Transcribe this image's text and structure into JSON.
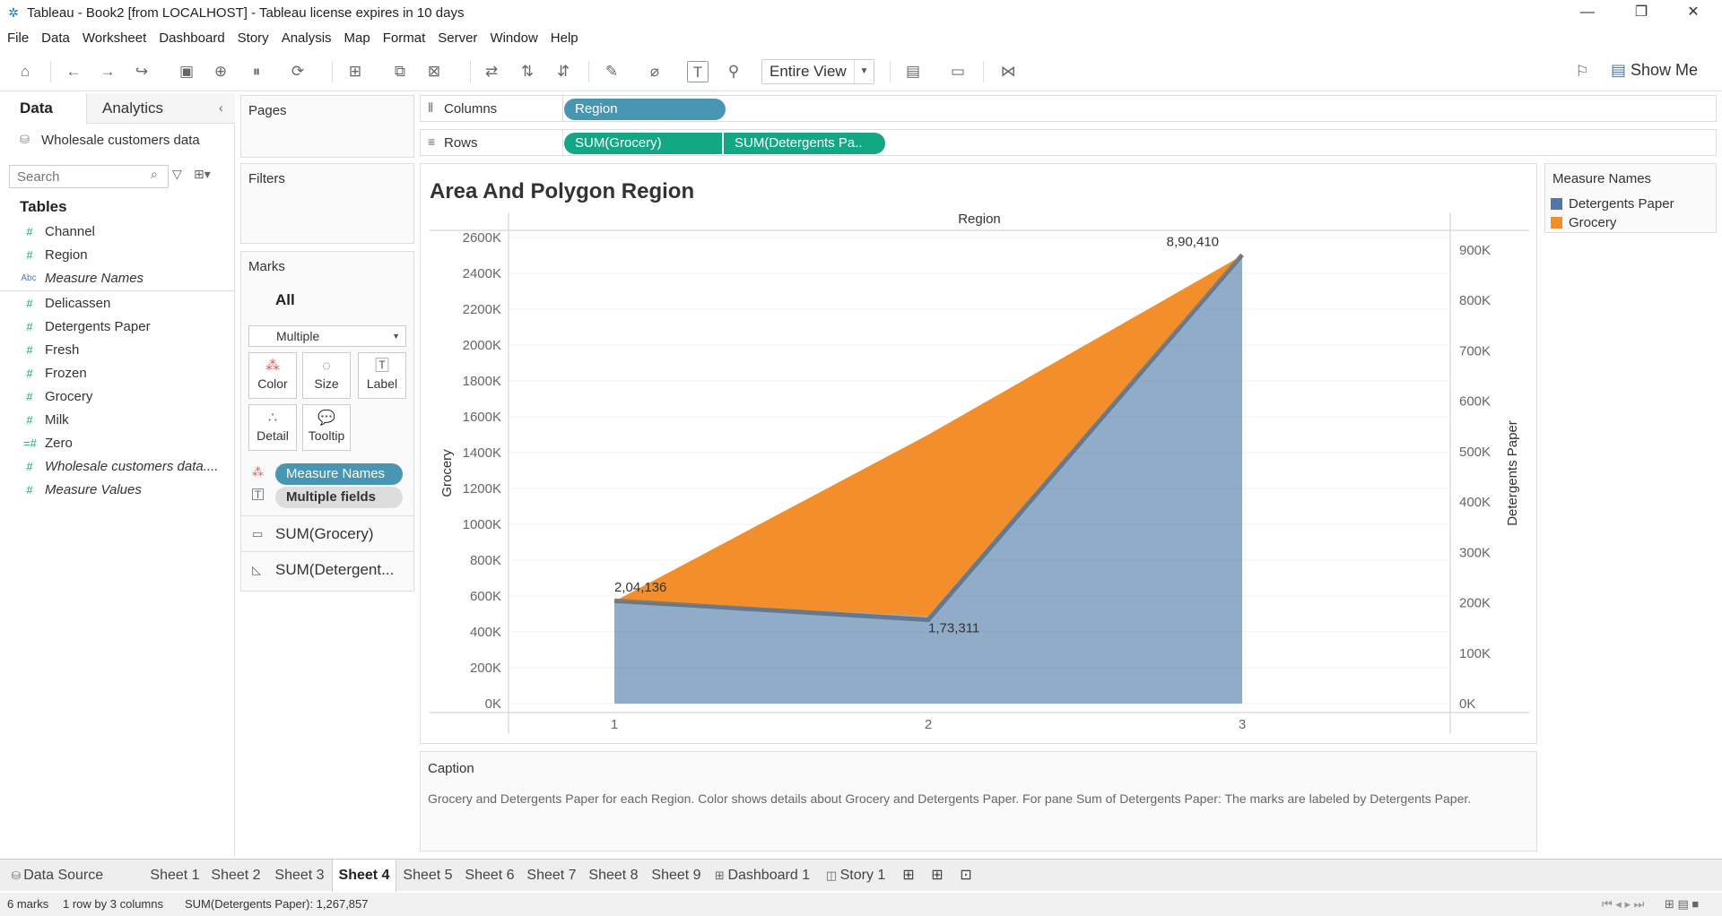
{
  "window": {
    "title": "Tableau - Book2 [from LOCALHOST] - Tableau license expires in 10 days",
    "controls": [
      "minimize",
      "restore",
      "close"
    ]
  },
  "menu": [
    "File",
    "Data",
    "Worksheet",
    "Dashboard",
    "Story",
    "Analysis",
    "Map",
    "Format",
    "Server",
    "Window",
    "Help"
  ],
  "toolbar": {
    "fit_label": "Entire View",
    "show_me_label": "Show Me"
  },
  "data_pane": {
    "tab_data": "Data",
    "tab_analytics": "Analytics",
    "datasource": "Wholesale customers data",
    "search_placeholder": "Search",
    "tables_heading": "Tables",
    "fields": [
      {
        "name": "Channel",
        "type": "measure",
        "italic": false
      },
      {
        "name": "Region",
        "type": "measure",
        "italic": false
      },
      {
        "name": "Measure Names",
        "type": "dimension",
        "italic": true
      },
      {
        "name": "Delicassen",
        "type": "measure",
        "italic": false
      },
      {
        "name": "Detergents Paper",
        "type": "measure",
        "italic": false
      },
      {
        "name": "Fresh",
        "type": "measure",
        "italic": false
      },
      {
        "name": "Frozen",
        "type": "measure",
        "italic": false
      },
      {
        "name": "Grocery",
        "type": "measure",
        "italic": false
      },
      {
        "name": "Milk",
        "type": "measure",
        "italic": false
      },
      {
        "name": "Zero",
        "type": "calc",
        "italic": false
      },
      {
        "name": "Wholesale customers data....",
        "type": "measure",
        "italic": true
      },
      {
        "name": "Measure Values",
        "type": "measure",
        "italic": true
      }
    ]
  },
  "pages_card": {
    "label": "Pages"
  },
  "filters_card": {
    "label": "Filters"
  },
  "marks_card": {
    "label": "Marks",
    "all_label": "All",
    "mark_type": "Multiple",
    "buttons": [
      "Color",
      "Size",
      "Label",
      "Detail",
      "Tooltip"
    ],
    "pills": [
      "Measure Names",
      "Multiple fields"
    ],
    "sub_marks": [
      "SUM(Grocery)",
      "SUM(Detergent..."
    ]
  },
  "shelves": {
    "columns_label": "Columns",
    "rows_label": "Rows",
    "columns_pills": [
      "Region"
    ],
    "rows_pills": [
      "SUM(Grocery)",
      "SUM(Detergents Pa.."
    ]
  },
  "viz": {
    "title": "Area And Polygon Region",
    "header": "Region",
    "left_axis_title": "Grocery",
    "right_axis_title": "Detergents Paper"
  },
  "chart_data": {
    "type": "area",
    "title": "Area And Polygon Region",
    "xlabel": "Region",
    "x": [
      1,
      2,
      3
    ],
    "y_left": {
      "label": "Grocery",
      "ylim": [
        0,
        2600000
      ],
      "ticks": [
        "0K",
        "200K",
        "400K",
        "600K",
        "800K",
        "1000K",
        "1200K",
        "1400K",
        "1600K",
        "1800K",
        "2000K",
        "2200K",
        "2400K",
        "2600K"
      ]
    },
    "y_right": {
      "label": "Detergents Paper",
      "ylim": [
        0,
        900000
      ],
      "ticks": [
        "0K",
        "100K",
        "200K",
        "300K",
        "400K",
        "500K",
        "600K",
        "700K",
        "800K",
        "900K"
      ]
    },
    "series": [
      {
        "name": "Grocery",
        "axis": "left",
        "color": "#f28e2b",
        "values": [
          570000,
          1500000,
          2500000
        ]
      },
      {
        "name": "Detergents Paper",
        "axis": "right",
        "color": "#4e79a7",
        "values": [
          204136,
          173311,
          890410
        ]
      }
    ],
    "data_labels": [
      "2,04,136",
      "1,73,311",
      "8,90,410"
    ],
    "legend": {
      "title": "Measure Names",
      "position": "right"
    }
  },
  "legend": {
    "title": "Measure Names",
    "items": [
      {
        "label": "Detergents Paper",
        "color": "#4e79a7"
      },
      {
        "label": "Grocery",
        "color": "#f28e2b"
      }
    ]
  },
  "caption": {
    "label": "Caption",
    "text": "Grocery and Detergents Paper for each Region.  Color shows details about Grocery and Detergents Paper.  For pane Sum of Detergents Paper:  The marks are labeled by Detergents Paper."
  },
  "sheet_tabs": {
    "data_source": "Data Source",
    "sheets": [
      "Sheet 1",
      "Sheet 2",
      "Sheet 3",
      "Sheet 4",
      "Sheet 5",
      "Sheet 6",
      "Sheet 7",
      "Sheet 8",
      "Sheet 9",
      "Dashboard 1",
      "Story 1"
    ],
    "active": "Sheet 4"
  },
  "status": {
    "marks": "6 marks",
    "dims": "1 row by 3 columns",
    "sum": "SUM(Detergents Paper): 1,267,857"
  }
}
